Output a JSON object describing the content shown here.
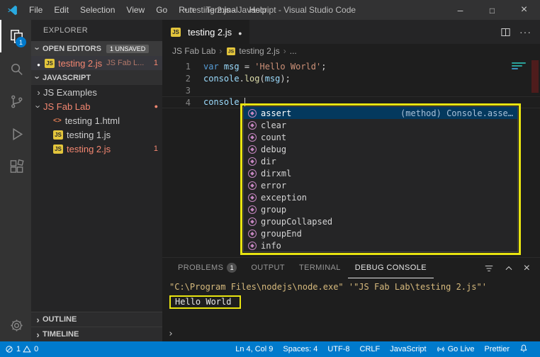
{
  "colors": {
    "accent": "#007acc",
    "annotation": "#e8e410",
    "error": "#f48771"
  },
  "title_bar": {
    "menus": [
      "File",
      "Edit",
      "Selection",
      "View",
      "Go",
      "Run",
      "Terminal",
      "Help"
    ],
    "title": "• testing 2.js - Javascript - Visual Studio Code"
  },
  "activity_bar": {
    "explorer_badge": "1"
  },
  "sidebar": {
    "header": "EXPLORER",
    "open_editors": {
      "label": "OPEN EDITORS",
      "badge": "1 UNSAVED",
      "file": {
        "name": "testing 2.js",
        "description": "JS Fab L...",
        "problems": "1"
      }
    },
    "section": {
      "label": "JAVASCRIPT",
      "items": [
        {
          "label": "JS Examples"
        },
        {
          "label": "JS Fab Lab"
        },
        {
          "label": "testing 1.html"
        },
        {
          "label": "testing 1.js"
        },
        {
          "label": "testing 2.js",
          "problems": "1"
        }
      ]
    },
    "outline_label": "OUTLINE",
    "timeline_label": "TIMELINE"
  },
  "editor": {
    "tab": {
      "label": "testing 2.js"
    },
    "breadcrumb": [
      {
        "label": "JS Fab Lab"
      },
      {
        "label": "testing 2.js"
      },
      {
        "label": "..."
      }
    ],
    "lines": [
      {
        "num": "1",
        "tokens": [
          {
            "t": "var",
            "c": "kw"
          },
          {
            "t": " ",
            "c": "plain"
          },
          {
            "t": "msg",
            "c": "var"
          },
          {
            "t": " = ",
            "c": "plain"
          },
          {
            "t": "'Hello World'",
            "c": "str"
          },
          {
            "t": ";",
            "c": "plain"
          }
        ]
      },
      {
        "num": "2",
        "tokens": [
          {
            "t": "console",
            "c": "var"
          },
          {
            "t": ".",
            "c": "plain"
          },
          {
            "t": "log",
            "c": "fn"
          },
          {
            "t": "(",
            "c": "plain"
          },
          {
            "t": "msg",
            "c": "var"
          },
          {
            "t": ");",
            "c": "plain"
          }
        ]
      },
      {
        "num": "3",
        "tokens": []
      },
      {
        "num": "4",
        "current": true,
        "cursor": true,
        "tokens": [
          {
            "t": "console",
            "c": "var"
          },
          {
            "t": ".",
            "c": "plain"
          }
        ]
      }
    ]
  },
  "suggest": {
    "items": [
      {
        "label": "assert",
        "detail": "(method) Console.asse…",
        "selected": true
      },
      {
        "label": "clear"
      },
      {
        "label": "count"
      },
      {
        "label": "debug"
      },
      {
        "label": "dir"
      },
      {
        "label": "dirxml"
      },
      {
        "label": "error"
      },
      {
        "label": "exception"
      },
      {
        "label": "group"
      },
      {
        "label": "groupCollapsed"
      },
      {
        "label": "groupEnd"
      },
      {
        "label": "info"
      }
    ]
  },
  "panel": {
    "tabs": [
      {
        "label": "PROBLEMS",
        "badge": "1"
      },
      {
        "label": "OUTPUT"
      },
      {
        "label": "TERMINAL"
      },
      {
        "label": "DEBUG CONSOLE",
        "active": true
      }
    ],
    "console_command": "\"C:\\Program Files\\nodejs\\node.exe\" '\"JS Fab Lab\\testing 2.js\"'",
    "console_output": "Hello World"
  },
  "status_bar": {
    "errors": "1",
    "warnings": "0",
    "items": [
      "Ln 4, Col 9",
      "Spaces: 4",
      "UTF-8",
      "CRLF",
      "JavaScript"
    ],
    "go_live": "Go Live",
    "prettier": "Prettier"
  }
}
